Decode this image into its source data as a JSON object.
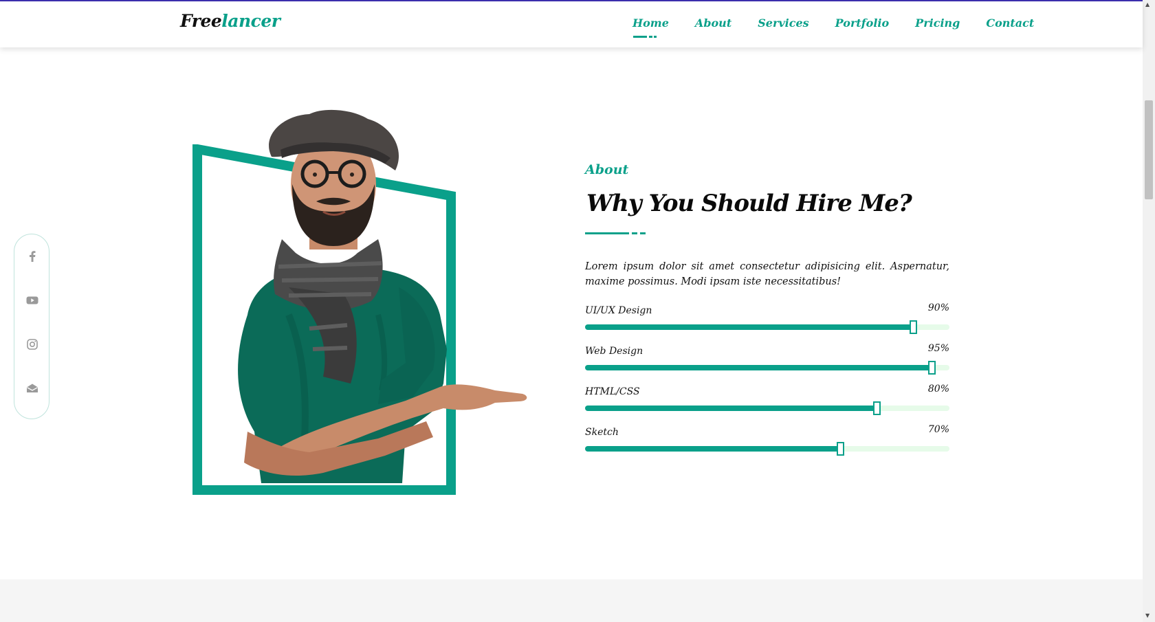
{
  "header": {
    "logo_part1": "Free",
    "logo_part2": "lancer",
    "nav": [
      {
        "label": "Home",
        "active": true
      },
      {
        "label": "About",
        "active": false
      },
      {
        "label": "Services",
        "active": false
      },
      {
        "label": "Portfolio",
        "active": false
      },
      {
        "label": "Pricing",
        "active": false
      },
      {
        "label": "Contact",
        "active": false
      }
    ]
  },
  "social": {
    "icons": [
      "facebook-icon",
      "youtube-icon",
      "instagram-icon",
      "mail-icon"
    ]
  },
  "about": {
    "label": "About",
    "heading": "Why You Should Hire Me?",
    "description": "Lorem ipsum dolor sit amet consectetur adipisicing elit. Aspernatur, maxime possimus. Modi ipsam iste necessitatibus!",
    "skills": [
      {
        "name": "UI/UX Design",
        "percent": "90%",
        "value": 0.9
      },
      {
        "name": "Web Design",
        "percent": "95%",
        "value": 0.95
      },
      {
        "name": "HTML/CSS",
        "percent": "80%",
        "value": 0.8
      },
      {
        "name": "Sketch",
        "percent": "70%",
        "value": 0.7
      }
    ]
  },
  "colors": {
    "accent": "#0aa08a",
    "track": "#e6fbe9",
    "top_accent": "#3b2fb0"
  }
}
